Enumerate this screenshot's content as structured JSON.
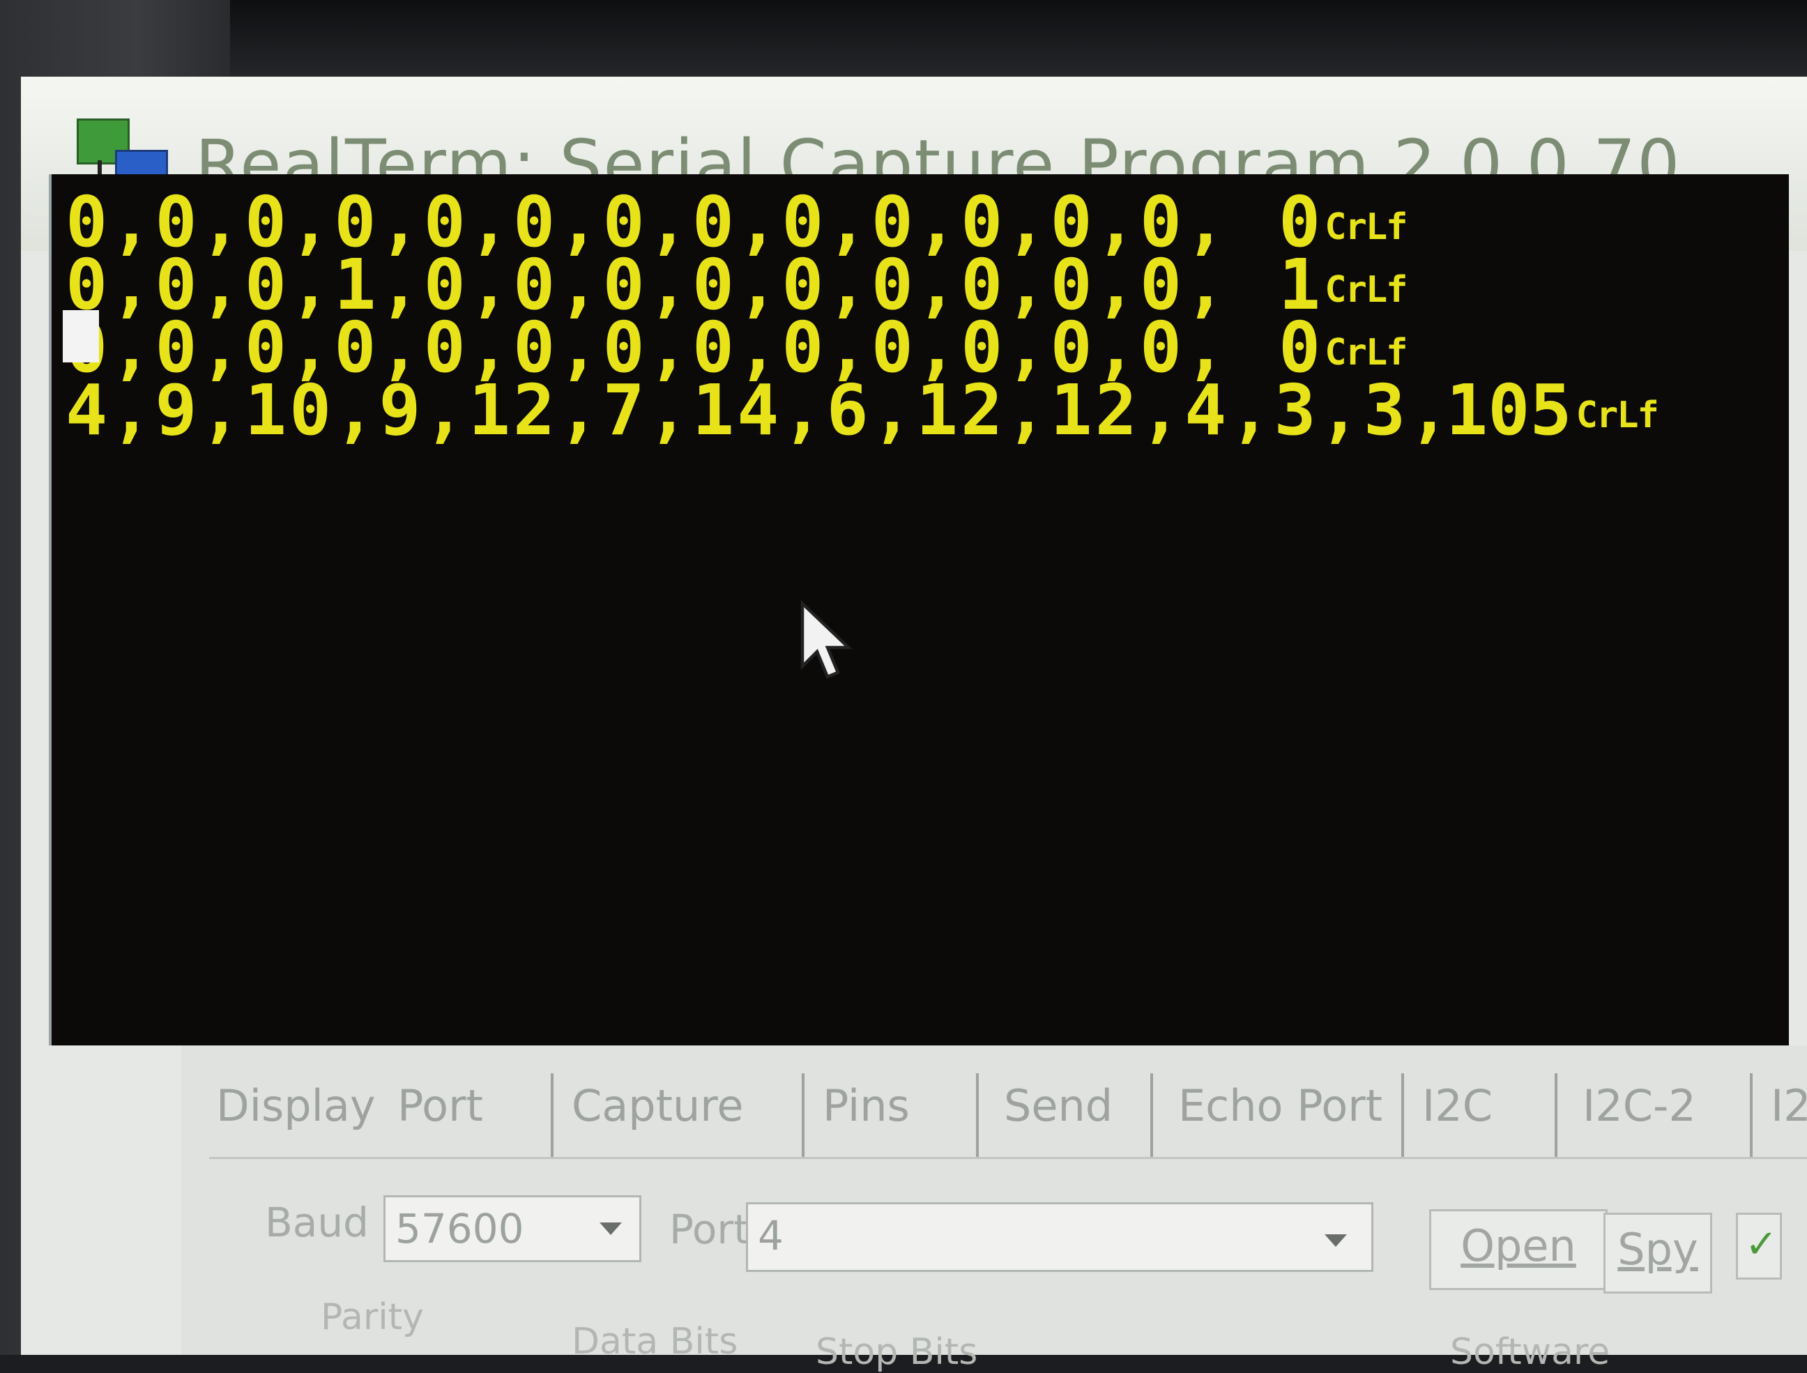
{
  "window": {
    "title": "RealTerm: Serial Capture Program 2.0.0.70"
  },
  "terminal": {
    "lines": [
      {
        "text": "0,0,0,0,0,0,0,0,0,0,0,0,0,",
        "count": "0",
        "eol": "CrLf"
      },
      {
        "text": "0,0,0,1,0,0,0,0,0,0,0,0,0,",
        "count": "1",
        "eol": "CrLf"
      },
      {
        "text": "0,0,0,0,0,0,0,0,0,0,0,0,0,",
        "count": "0",
        "eol": "CrLf"
      },
      {
        "text": "4,9,10,9,12,7,14,6,12,12,4,3,3,",
        "count": "105",
        "eol": "CrLf"
      }
    ]
  },
  "tabs": [
    "Display",
    "Port",
    "Capture",
    "Pins",
    "Send",
    "Echo Port",
    "I2C",
    "I2C-2",
    "I2"
  ],
  "port_panel": {
    "baud_label": "Baud",
    "baud_value": "57600",
    "port_label": "Port",
    "port_value": "4",
    "open_label": "Open",
    "spy_label": "Spy",
    "parity_label": "Parity",
    "data_bits_label": "Data Bits",
    "stop_bits_label": "Stop Bits",
    "software_label": "Software"
  },
  "icons": {
    "app": "realterm-app-icon",
    "pointer": "mouse-pointer-icon",
    "dropdown": "chevron-down-icon"
  },
  "colors": {
    "terminal_bg": "#0b0a08",
    "terminal_fg": "#e8e319"
  }
}
